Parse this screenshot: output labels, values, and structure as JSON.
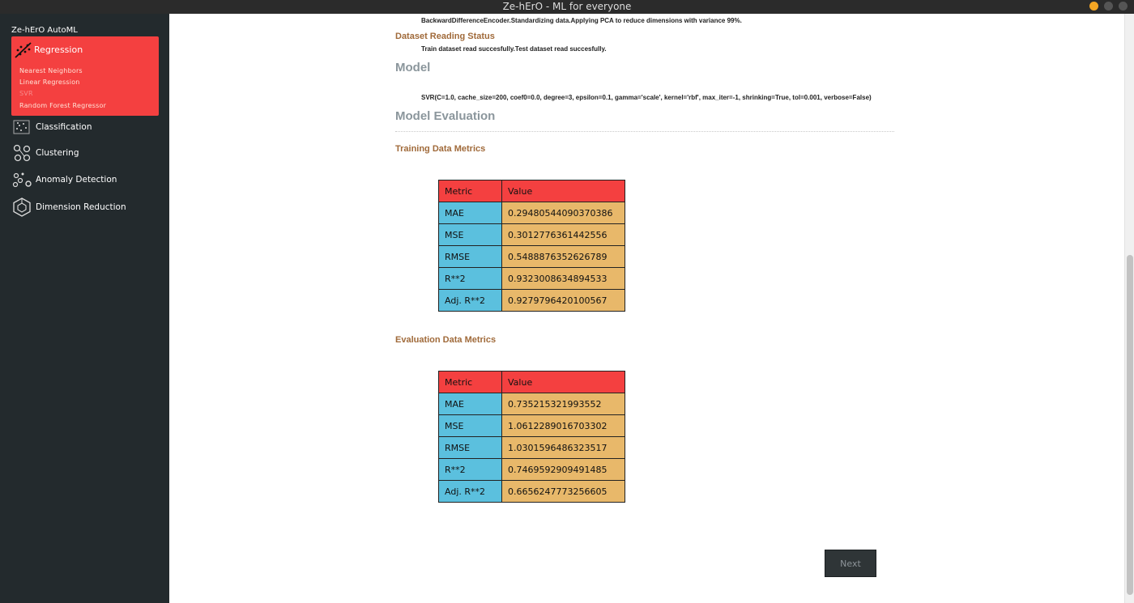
{
  "window": {
    "title": "Ze-hErO - ML for everyone"
  },
  "colors": {
    "accent": "#f44040",
    "sidebar_bg": "#232a2d",
    "metric_cell": "#5bc0de",
    "value_cell": "#e8b86a",
    "heading": "#a06a3a"
  },
  "sidebar": {
    "app_name": "Ze-hErO AutoML",
    "regression": {
      "label": "Regression",
      "icon": "regression-icon",
      "items": [
        "Nearest Neighbors",
        "Linear Regression",
        "SVR",
        "Random Forest Regressor"
      ]
    },
    "nav": [
      {
        "label": "Classification",
        "icon": "classification-icon"
      },
      {
        "label": "Clustering",
        "icon": "clustering-icon"
      },
      {
        "label": "Anomaly Detection",
        "icon": "anomaly-icon"
      },
      {
        "label": "Dimension Reduction",
        "icon": "dimension-reduction-icon"
      }
    ]
  },
  "main": {
    "preprocess_text": "BackwardDifferenceEncoder.Standardizing data.Applying PCA to reduce dimensions with variance 99%.",
    "dataset_status": {
      "title": "Dataset Reading Status",
      "text": "Train dataset read succesfully.Test dataset read succesfully."
    },
    "model": {
      "title": "Model",
      "text": "SVR(C=1.0, cache_size=200, coef0=0.0, degree=3, epsilon=0.1, gamma='scale', kernel='rbf', max_iter=-1, shrinking=True, tol=0.001, verbose=False)"
    },
    "evaluation": {
      "title": "Model Evaluation",
      "training": {
        "title": "Training Data Metrics",
        "header": [
          "Metric",
          "Value"
        ],
        "rows": [
          [
            "MAE",
            "0.29480544090370386"
          ],
          [
            "MSE",
            "0.3012776361442556"
          ],
          [
            "RMSE",
            "0.5488876352626789"
          ],
          [
            "R**2",
            "0.9323008634894533"
          ],
          [
            "Adj. R**2",
            "0.9279796420100567"
          ]
        ]
      },
      "eval": {
        "title": "Evaluation Data Metrics",
        "header": [
          "Metric",
          "Value"
        ],
        "rows": [
          [
            "MAE",
            "0.735215321993552"
          ],
          [
            "MSE",
            "1.0612289016703302"
          ],
          [
            "RMSE",
            "1.0301596486323517"
          ],
          [
            "R**2",
            "0.7469592909491485"
          ],
          [
            "Adj. R**2",
            "0.6656247773256605"
          ]
        ]
      }
    },
    "next_label": "Next"
  }
}
